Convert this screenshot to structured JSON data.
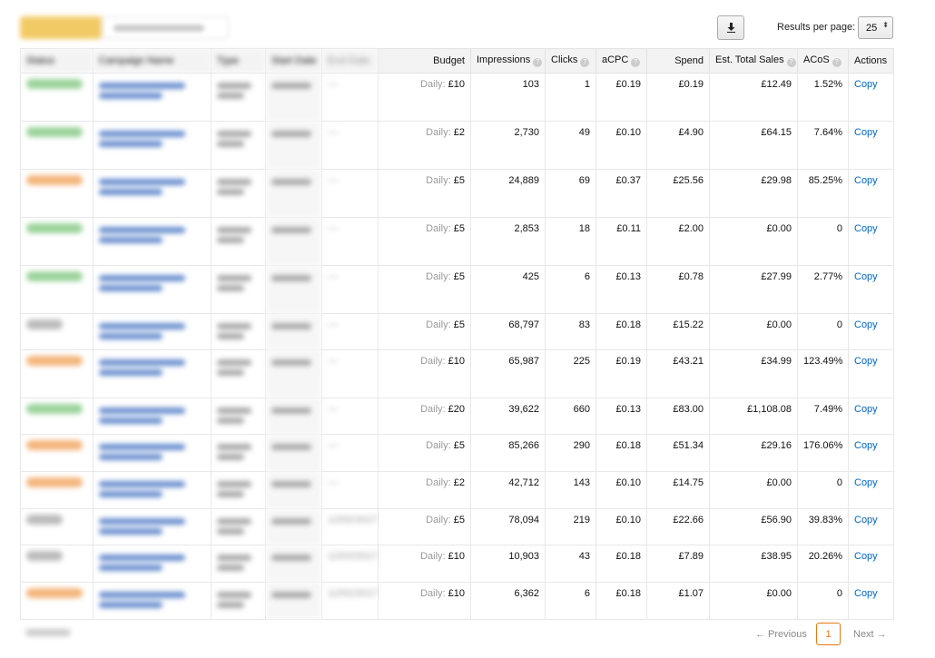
{
  "toolbar": {
    "download_icon": "download-icon",
    "rpp_label": "Results per page:",
    "rpp_value": "25",
    "rpp_arrow": "⬍"
  },
  "columns": {
    "status": "Status",
    "campaign": "Campaign Name",
    "type": "Type",
    "start": "Start Date",
    "end": "End Date",
    "budget": "Budget",
    "impressions": "Impressions",
    "clicks": "Clicks",
    "acpc": "aCPC",
    "spend": "Spend",
    "sales": "Est. Total Sales",
    "acos": "ACoS",
    "actions": "Actions"
  },
  "rows": [
    {
      "status": "green",
      "end": "—",
      "budget_prefix": "Daily:",
      "budget": "£10",
      "impressions": "103",
      "clicks": "1",
      "acpc": "£0.19",
      "spend": "£0.19",
      "sales": "£12.49",
      "acos": "1.52%",
      "action": "Copy",
      "h": 53
    },
    {
      "status": "green",
      "end": "—",
      "budget_prefix": "Daily:",
      "budget": "£2",
      "impressions": "2,730",
      "clicks": "49",
      "acpc": "£0.10",
      "spend": "£4.90",
      "sales": "£64.15",
      "acos": "7.64%",
      "action": "Copy",
      "h": 53
    },
    {
      "status": "orange",
      "end": "—",
      "budget_prefix": "Daily:",
      "budget": "£5",
      "impressions": "24,889",
      "clicks": "69",
      "acpc": "£0.37",
      "spend": "£25.56",
      "sales": "£29.98",
      "acos": "85.25%",
      "action": "Copy",
      "h": 53
    },
    {
      "status": "green",
      "end": "—",
      "budget_prefix": "Daily:",
      "budget": "£5",
      "impressions": "2,853",
      "clicks": "18",
      "acpc": "£0.11",
      "spend": "£2.00",
      "sales": "£0.00",
      "acos": "0",
      "action": "Copy",
      "h": 53
    },
    {
      "status": "green",
      "end": "—",
      "budget_prefix": "Daily:",
      "budget": "£5",
      "impressions": "425",
      "clicks": "6",
      "acpc": "£0.13",
      "spend": "£0.78",
      "sales": "£27.99",
      "acos": "2.77%",
      "action": "Copy",
      "h": 53
    },
    {
      "status": "gray",
      "end": "—",
      "budget_prefix": "Daily:",
      "budget": "£5",
      "impressions": "68,797",
      "clicks": "83",
      "acpc": "£0.18",
      "spend": "£15.22",
      "sales": "£0.00",
      "acos": "0",
      "action": "Copy",
      "h": 40
    },
    {
      "status": "orange",
      "end": "—",
      "budget_prefix": "Daily:",
      "budget": "£10",
      "impressions": "65,987",
      "clicks": "225",
      "acpc": "£0.19",
      "spend": "£43.21",
      "sales": "£34.99",
      "acos": "123.49%",
      "action": "Copy",
      "h": 53
    },
    {
      "status": "green",
      "end": "—",
      "budget_prefix": "Daily:",
      "budget": "£20",
      "impressions": "39,622",
      "clicks": "660",
      "acpc": "£0.13",
      "spend": "£83.00",
      "sales": "£1,108.08",
      "acos": "7.49%",
      "action": "Copy",
      "h": 40
    },
    {
      "status": "orange",
      "end": "—",
      "budget_prefix": "Daily:",
      "budget": "£5",
      "impressions": "85,266",
      "clicks": "290",
      "acpc": "£0.18",
      "spend": "£51.34",
      "sales": "£29.16",
      "acos": "176.06%",
      "action": "Copy",
      "h": 41
    },
    {
      "status": "orange",
      "end": "—",
      "budget_prefix": "Daily:",
      "budget": "£2",
      "impressions": "42,712",
      "clicks": "143",
      "acpc": "£0.10",
      "spend": "£14.75",
      "sales": "£0.00",
      "acos": "0",
      "action": "Copy",
      "h": 41
    },
    {
      "status": "gray",
      "end": "12/02/2017",
      "budget_prefix": "Daily:",
      "budget": "£5",
      "impressions": "78,094",
      "clicks": "219",
      "acpc": "£0.10",
      "spend": "£22.66",
      "sales": "£56.90",
      "acos": "39.83%",
      "action": "Copy",
      "h": 40
    },
    {
      "status": "gray",
      "end": "12/02/2017",
      "budget_prefix": "Daily:",
      "budget": "£10",
      "impressions": "10,903",
      "clicks": "43",
      "acpc": "£0.18",
      "spend": "£7.89",
      "sales": "£38.95",
      "acos": "20.26%",
      "action": "Copy",
      "h": 41
    },
    {
      "status": "orange",
      "end": "12/02/2017",
      "budget_prefix": "Daily:",
      "budget": "£10",
      "impressions": "6,362",
      "clicks": "6",
      "acpc": "£0.18",
      "spend": "£1.07",
      "sales": "£0.00",
      "acos": "0",
      "action": "Copy",
      "h": 41
    }
  ],
  "pagination": {
    "prev": "← Previous",
    "current": "1",
    "next": "Next →"
  }
}
